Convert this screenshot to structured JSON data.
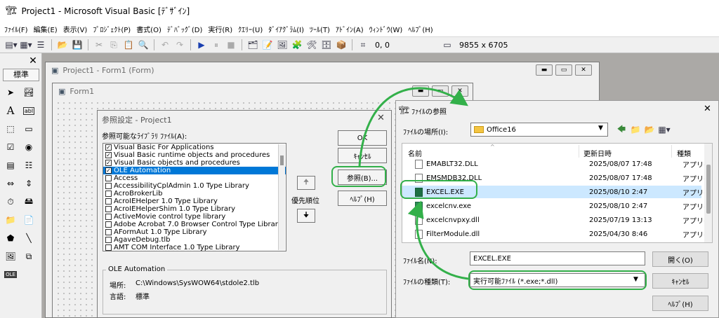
{
  "app": {
    "title": "Project1 - Microsoft Visual Basic [ﾃﾞｻﾞｲﾝ]",
    "menu": [
      "ﾌｧｲﾙ(F)",
      "編集(E)",
      "表示(V)",
      "ﾌﾟﾛｼﾞｪｸﾄ(P)",
      "書式(O)",
      "ﾃﾞﾊﾞｯｸﾞ(D)",
      "実行(R)",
      "ｸｴﾘｰ(U)",
      "ﾀﾞｲｱｸﾞﾗﾑ(I)",
      "ﾂｰﾙ(T)",
      "ｱﾄﾞｲﾝ(A)",
      "ｳｨﾝﾄﾞｳ(W)",
      "ﾍﾙﾌﾟ(H)"
    ],
    "toolbar": {
      "position": "0, 0",
      "size": "9855 x 6705"
    }
  },
  "toolbox": {
    "title": "標準",
    "close": "✕"
  },
  "project_window": {
    "title": "Project1 - Form1 (Form)"
  },
  "form_window": {
    "title": "Form1"
  },
  "refs_dialog": {
    "title": "参照設定 - Project1",
    "list_label": "参照可能なﾗｲﾌﾞﾗﾘ ﾌｧｲﾙ(A):",
    "items": [
      {
        "label": "Visual Basic For Applications",
        "checked": true
      },
      {
        "label": "Visual Basic runtime objects and procedures",
        "checked": true
      },
      {
        "label": "Visual Basic objects and procedures",
        "checked": true
      },
      {
        "label": "OLE Automation",
        "checked": true,
        "selected": true
      },
      {
        "label": "Access",
        "checked": false
      },
      {
        "label": "AccessibilityCplAdmin 1.0 Type Library",
        "checked": false
      },
      {
        "label": "AcroBrokerLib",
        "checked": false
      },
      {
        "label": "AcroIEHelper 1.0 Type Library",
        "checked": false
      },
      {
        "label": "AcroIEHelperShim 1.0 Type Library",
        "checked": false
      },
      {
        "label": "ActiveMovie control type library",
        "checked": false
      },
      {
        "label": "Adobe Acrobat 7.0 Browser Control Type Library",
        "checked": false
      },
      {
        "label": "AFormAut 1.0 Type Library",
        "checked": false
      },
      {
        "label": "AgaveDebug.tlb",
        "checked": false
      },
      {
        "label": "AMT COM Interface 1.0 Type Library",
        "checked": false
      }
    ],
    "ok_label": "OK",
    "cancel_label": "ｷｬﾝｾﾙ",
    "browse_label": "参照(B)...",
    "help_label": "ﾍﾙﾌﾟ(H)",
    "priority_label": "優先順位",
    "group_title": "OLE Automation",
    "location_label": "場所:",
    "location_value": "C:\\Windows\\SysWOW64\\stdole2.tlb",
    "language_label": "言語:",
    "language_value": "標準"
  },
  "file_dialog": {
    "title": "ﾌｧｲﾙの参照",
    "location_label": "ﾌｧｲﾙの場所(I):",
    "location_value": "Office16",
    "columns": [
      "名前",
      "更新日時",
      "種類"
    ],
    "files": [
      {
        "name": "EMABLT32.DLL",
        "date": "2025/08/07 17:48",
        "type": "アプリケ",
        "icon": "dll-icon"
      },
      {
        "name": "EMSMDB32.DLL",
        "date": "2025/08/07 17:48",
        "type": "アプリケ",
        "icon": "dll-icon"
      },
      {
        "name": "EXCEL.EXE",
        "date": "2025/08/10 2:47",
        "type": "アプリケ",
        "icon": "excel-icon",
        "selected": true
      },
      {
        "name": "excelcnv.exe",
        "date": "2025/08/10 2:47",
        "type": "アプリケ",
        "icon": "exe-icon"
      },
      {
        "name": "excelcnvpxy.dll",
        "date": "2025/07/19 13:13",
        "type": "アプリケ",
        "icon": "dll-icon"
      },
      {
        "name": "FilterModule.dll",
        "date": "2025/04/30 8:46",
        "type": "アプリケ",
        "icon": "dll-icon"
      }
    ],
    "filename_label": "ﾌｧｲﾙ名(N):",
    "filename_value": "EXCEL.EXE",
    "filetype_label": "ﾌｧｲﾙの種類(T):",
    "filetype_value": "実行可能ﾌｧｲﾙ (*.exe;*.dll)",
    "open_label": "開く(O)",
    "cancel_label": "ｷｬﾝｾﾙ",
    "help_label": "ﾍﾙﾌﾟ(H)"
  },
  "colors": {
    "highlight_green": "#33b04a",
    "selection_blue": "#0078d7",
    "row_highlight": "#cce8ff"
  }
}
